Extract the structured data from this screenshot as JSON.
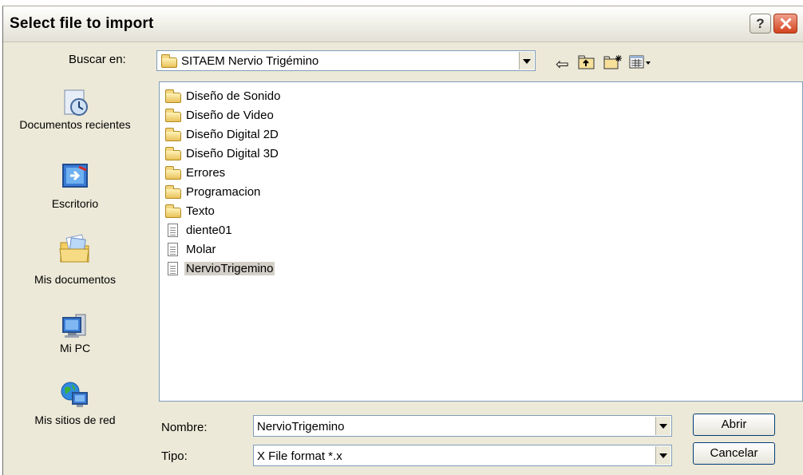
{
  "window": {
    "title": "Select file to import",
    "help_label": "?"
  },
  "lookin": {
    "label": "Buscar en:",
    "value": "SITAEM Nervio Trigémino"
  },
  "toolbar": {
    "icons": [
      "back-arrow-icon",
      "up-folder-icon",
      "new-folder-icon",
      "view-menu-icon"
    ]
  },
  "places": [
    {
      "label": "Documentos recientes",
      "icon": "recent-documents-icon"
    },
    {
      "label": "Escritorio",
      "icon": "desktop-icon"
    },
    {
      "label": "Mis documentos",
      "icon": "my-documents-icon"
    },
    {
      "label": "Mi PC",
      "icon": "my-computer-icon"
    },
    {
      "label": "Mis sitios de red",
      "icon": "network-places-icon"
    }
  ],
  "files": [
    {
      "name": "Diseño de Sonido",
      "type": "folder"
    },
    {
      "name": "Diseño de Video",
      "type": "folder"
    },
    {
      "name": "Diseño Digital 2D",
      "type": "folder"
    },
    {
      "name": "Diseño Digital 3D",
      "type": "folder"
    },
    {
      "name": "Errores",
      "type": "folder"
    },
    {
      "name": "Programacion",
      "type": "folder"
    },
    {
      "name": "Texto",
      "type": "folder"
    },
    {
      "name": "diente01",
      "type": "file"
    },
    {
      "name": "Molar",
      "type": "file"
    },
    {
      "name": "NervioTrigemino",
      "type": "file",
      "selected": true
    }
  ],
  "filename": {
    "label": "Nombre:",
    "value": "NervioTrigemino"
  },
  "filetype": {
    "label": "Tipo:",
    "value": "X File format *.x"
  },
  "buttons": {
    "open": "Abrir",
    "cancel": "Cancelar"
  },
  "colors": {
    "dialog_bg": "#ece9d8",
    "selection": "#d4d0c8",
    "close_red": "#d4431e"
  }
}
